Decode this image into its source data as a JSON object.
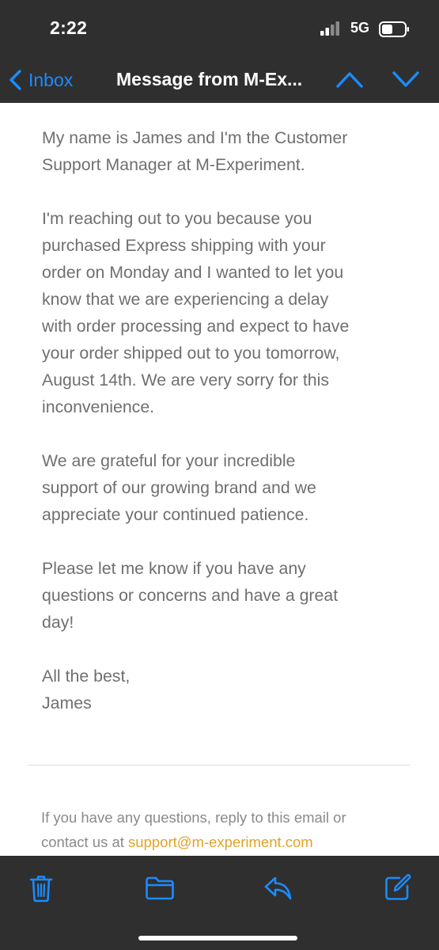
{
  "status": {
    "time": "2:22",
    "network": "5G"
  },
  "nav": {
    "back_label": "Inbox",
    "title": "Message from M-Ex..."
  },
  "message": {
    "paragraphs": [
      "My name is James and I'm the Customer\nSupport Manager at M-Experiment.",
      "I'm reaching out to you because you\npurchased Express shipping with your\norder on Monday and I wanted to let you\nknow that we are experiencing a delay\nwith order processing and expect to have\nyour order shipped out to you tomorrow,\nAugust 14th. We are very sorry for this\ninconvenience.",
      "We are grateful for your incredible\nsupport of our growing brand and we\nappreciate your continued patience.",
      "Please let me know if you have any\nquestions or concerns and have a great\nday!"
    ],
    "signoff": "All the best,\nJames"
  },
  "footer": {
    "text": "If you have any questions, reply to this email or\ncontact us at ",
    "email": "support@m-experiment.com"
  },
  "colors": {
    "chrome_bg": "#2f2f2f",
    "accent_blue": "#1a8cff",
    "link_orange": "#e0a326",
    "body_text": "#6f6f6f"
  },
  "icons": [
    "signal-icon",
    "battery-icon",
    "chevron-left-icon",
    "chevron-up-icon",
    "chevron-down-icon",
    "trash-icon",
    "folder-icon",
    "reply-icon",
    "compose-icon"
  ]
}
